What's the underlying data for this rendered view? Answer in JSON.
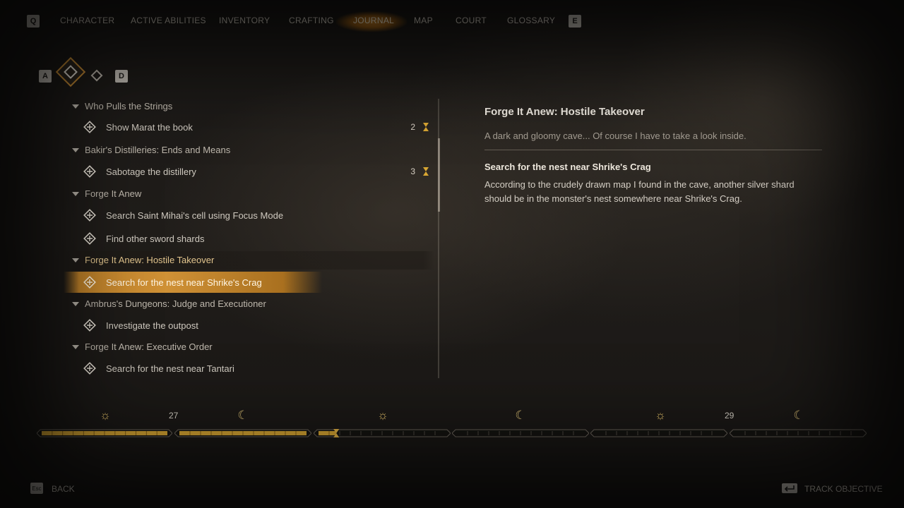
{
  "nav": {
    "left_key": "Q",
    "right_key": "E",
    "tabs": [
      "CHARACTER",
      "ACTIVE ABILITIES",
      "INVENTORY",
      "CRAFTING",
      "JOURNAL",
      "MAP",
      "COURT",
      "GLOSSARY"
    ],
    "active_tab": "JOURNAL"
  },
  "subtabs": {
    "left_key": "A",
    "right_key": "D"
  },
  "quests": [
    {
      "type": "quest",
      "label": "Who Pulls the Strings"
    },
    {
      "type": "objective",
      "label": "Show Marat the book",
      "count": "2",
      "timed": true
    },
    {
      "type": "quest",
      "label": "Bakir's Distilleries: Ends and Means"
    },
    {
      "type": "objective",
      "label": "Sabotage the distillery",
      "count": "3",
      "timed": true
    },
    {
      "type": "quest",
      "label": "Forge It Anew"
    },
    {
      "type": "objective",
      "label": "Search Saint Mihai's cell using Focus Mode"
    },
    {
      "type": "objective",
      "label": "Find other sword shards"
    },
    {
      "type": "quest",
      "label": "Forge It Anew: Hostile Takeover",
      "selected": true
    },
    {
      "type": "objective",
      "label": "Search for the nest near Shrike's Crag",
      "selected": true
    },
    {
      "type": "quest",
      "label": "Ambrus's Dungeons: Judge and Executioner"
    },
    {
      "type": "objective",
      "label": "Investigate the outpost"
    },
    {
      "type": "quest",
      "label": "Forge It Anew: Executive Order"
    },
    {
      "type": "objective",
      "label": "Search for the nest near Tantari"
    }
  ],
  "details": {
    "title": "Forge It Anew: Hostile Takeover",
    "subtitle": "A dark and gloomy cave... Of course I have to take a look inside.",
    "objective_title": "Search for the nest near Shrike's Crag",
    "objective_desc": "According to the crudely drawn map I found in the cave, another silver shard should be in the monster's nest somewhere near Shrike's Crag."
  },
  "timeline": {
    "markers": [
      {
        "icon": "sun-icon",
        "glyph": "☼"
      },
      {
        "icon": "moon-icon",
        "glyph": "☾"
      },
      {
        "icon": "sun-icon",
        "glyph": "☼"
      },
      {
        "icon": "moon-icon",
        "glyph": "☾"
      },
      {
        "icon": "sun-icon",
        "glyph": "☼"
      },
      {
        "icon": "moon-icon",
        "glyph": "☾"
      }
    ],
    "day_labels": [
      "27",
      "29"
    ],
    "segment_fill": [
      1.0,
      1.0,
      0.14,
      0,
      0,
      0
    ],
    "fill_color": "#d9a733"
  },
  "bottom": {
    "back_key": "Esc",
    "back_label": "BACK",
    "track_label": "TRACK OBJECTIVE"
  }
}
